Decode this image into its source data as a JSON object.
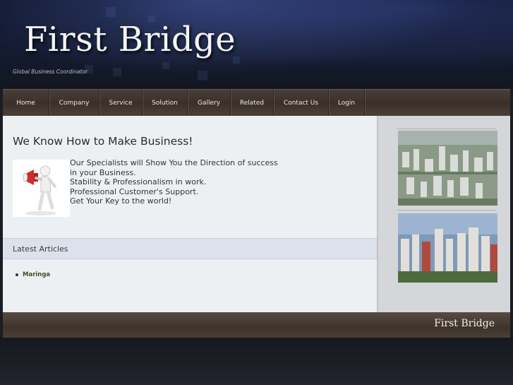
{
  "header": {
    "title": "First Bridge",
    "tagline": "Global Business Coordinator"
  },
  "nav": {
    "items": [
      {
        "label": "Home"
      },
      {
        "label": "Company"
      },
      {
        "label": "Service"
      },
      {
        "label": "Solution"
      },
      {
        "label": "Gallery"
      },
      {
        "label": "Related"
      },
      {
        "label": "Contact Us"
      },
      {
        "label": "Login"
      }
    ]
  },
  "main": {
    "heading": "We Know How to Make Business!",
    "intro_lines": [
      "Our Specialists will Show You the Direction of success",
      "in your Business.",
      "Stability & Professionalism in work.",
      "Professional Customer's Support.",
      "Get Your Key to the world!"
    ],
    "illustration_icon": "megaphone-figure-icon"
  },
  "articles": {
    "title": "Latest Articles",
    "items": [
      "Maringa"
    ]
  },
  "sidebar": {
    "photos": [
      "city-aerial-photo",
      "city-skyline-photo"
    ]
  },
  "footer": {
    "logo": "First Bridge"
  },
  "colors": {
    "nav_background": "#3a3029",
    "header_background": "#0d1428",
    "main_background": "#edf0f3",
    "sidebar_background": "#d5d6d9"
  }
}
